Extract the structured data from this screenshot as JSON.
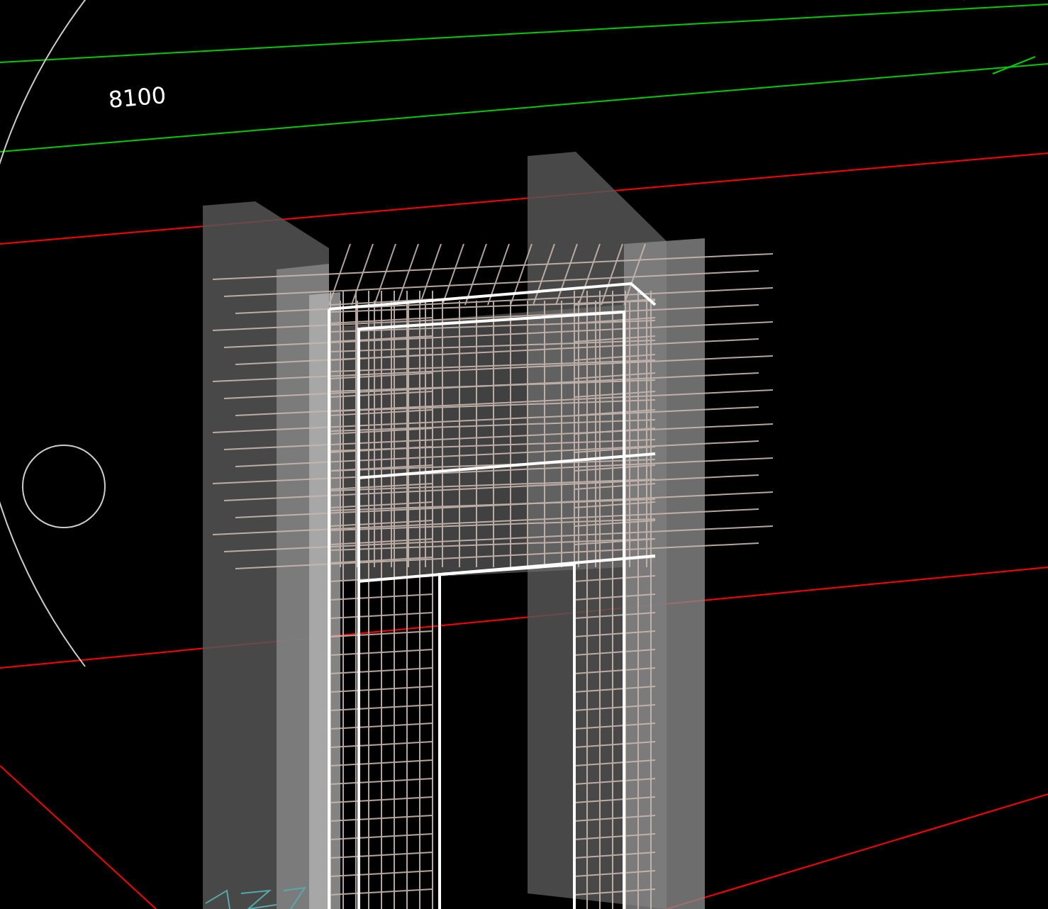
{
  "viewport": {
    "dimension_label": "8100"
  }
}
